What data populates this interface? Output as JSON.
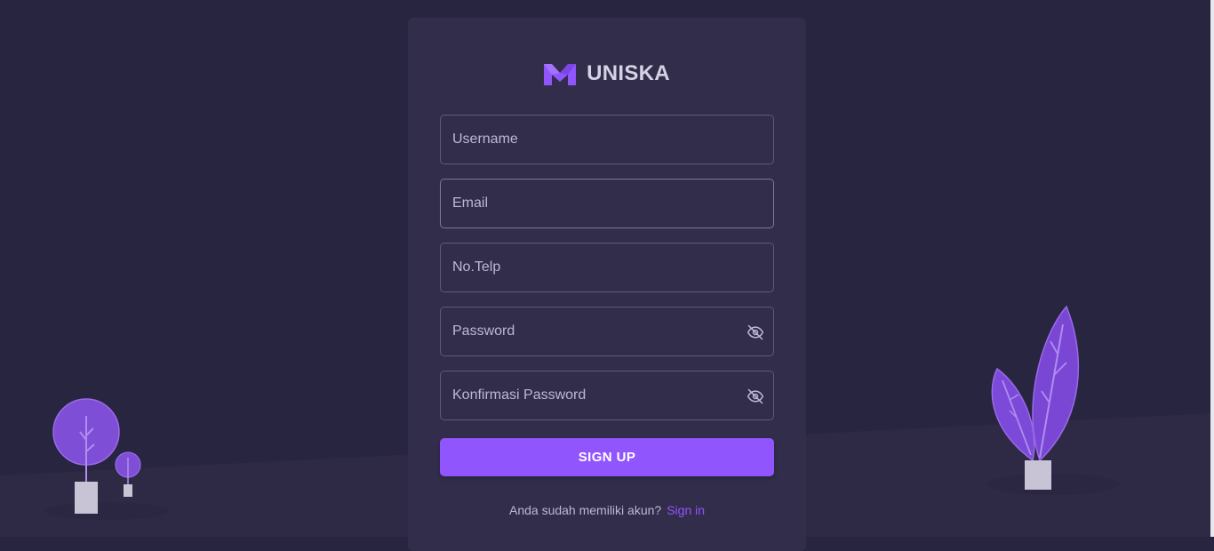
{
  "app": {
    "name": "UNISKA"
  },
  "form": {
    "username_placeholder": "Username",
    "email_placeholder": "Email",
    "phone_placeholder": "No.Telp",
    "password_placeholder": "Password",
    "confirm_password_placeholder": "Konfirmasi Password"
  },
  "actions": {
    "signup_label": "SIGN UP"
  },
  "footer": {
    "question": "Anda sudah memiliki akun?",
    "signin_label": "Sign in"
  },
  "icons": {
    "logo": "m-logo-icon",
    "password_toggle": "eye-off-icon"
  },
  "colors": {
    "primary": "#9155fd",
    "background": "#282540",
    "card": "#312d4b",
    "text": "#d6d2e6"
  }
}
